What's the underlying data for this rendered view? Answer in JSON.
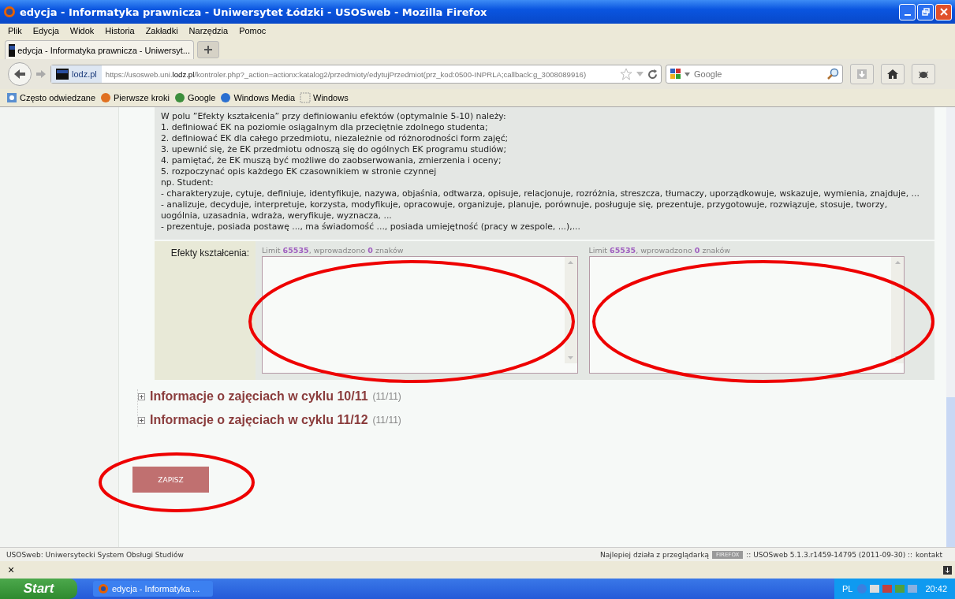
{
  "window": {
    "title": "edycja - Informatyka prawnicza - Uniwersytet Łódzki - USOSweb - Mozilla Firefox"
  },
  "menu": [
    "Plik",
    "Edycja",
    "Widok",
    "Historia",
    "Zakładki",
    "Narzędzia",
    "Pomoc"
  ],
  "tabs": [
    {
      "label": "edycja - Informatyka prawnicza - Uniwersyt...",
      "selected": true
    }
  ],
  "address": {
    "site": "lodz.pl",
    "url": "https://usosweb.uni.**lodz.pl**/kontroler.php?_action=actionx:katalog2/przedmioty/edytujPrzedmiot(prz_kod:0500-INPRLA;callback:g_3008089916)"
  },
  "search": {
    "placeholder": "Google"
  },
  "bookmarks": [
    {
      "label": "Często odwiedzane",
      "kind": "page"
    },
    {
      "label": "Pierwsze kroki",
      "kind": "firefox"
    },
    {
      "label": "Google",
      "kind": "google"
    },
    {
      "label": "Windows Media",
      "kind": "windows"
    },
    {
      "label": "Windows",
      "kind": "blank"
    }
  ],
  "instructions": [
    "W polu ”Efekty kształcenia” przy definiowaniu efektów (optymalnie 5-10) należy:",
    "1. definiować EK na poziomie osiągalnym dla przeciętnie zdolnego studenta;",
    "2. definiować EK dla całego przedmiotu, niezależnie od różnorodności form zajęć;",
    "3. upewnić się, że EK przedmiotu odnoszą się do ogólnych EK programu studiów;",
    "4. pamiętać, że EK muszą być możliwe do zaobserwowania, zmierzenia i oceny;",
    "5. rozpoczynać opis każdego EK czasownikiem w stronie czynnej",
    "np. Student:",
    "- charakteryzuje, cytuje, definiuje, identyfikuje, nazywa, objaśnia, odtwarza, opisuje, relacjonuje, rozróżnia, streszcza, tłumaczy, uporządkowuje, wskazuje, wymienia, znajduje, ...",
    "- analizuje, decyduje, interpretuje, korzysta, modyfikuje, opracowuje, organizuje, planuje, porównuje, posługuje się, prezentuje, przygotowuje, rozwiązuje, stosuje, tworzy, uogólnia, uzasadnia, wdraża, weryfikuje, wyznacza, ...",
    "- prezentuje, posiada postawę ..., ma świadomość ..., posiada umiejętność (pracy w zespole, ...),..."
  ],
  "form": {
    "label": "Efekty kształcenia:",
    "fields": [
      {
        "counter": "Limit **65535**, wprowadzono **0** znaków"
      },
      {
        "counter": "Limit **65535**, wprowadzono **0** znaków"
      }
    ]
  },
  "sections": [
    {
      "title": "Informacje o zajęciach w cyklu 10/11",
      "count": "(11/11)"
    },
    {
      "title": "Informacje o zajęciach w cyklu 11/12",
      "count": "(11/11)"
    }
  ],
  "save_button": "ZAPISZ",
  "status_bar": {
    "left": "USOSweb: Uniwersytecki System Obsługi Studiów",
    "prefix": "Najlepiej działa z przeglądarką",
    "badge": "FIREFOX",
    "version": ":: USOSweb 5.1.3.r1459-14795 (2011-09-30) ::",
    "link": "kontakt"
  },
  "addon_bar": {
    "close": "×"
  },
  "taskbar": {
    "start": "Start",
    "task": "edycja - Informatyka ...",
    "language": "PL",
    "clock": "20:42"
  }
}
